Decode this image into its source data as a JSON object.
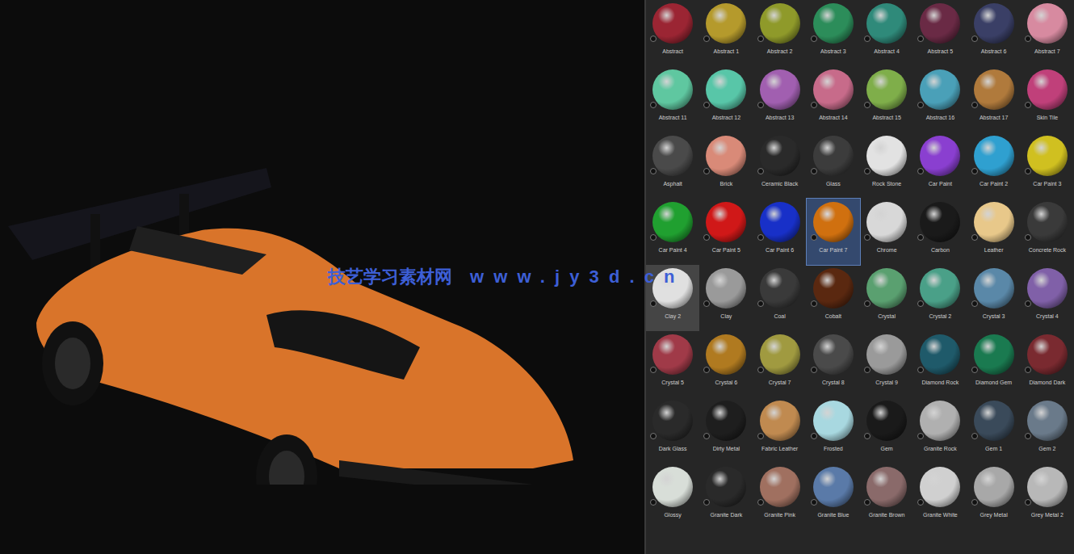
{
  "watermark": {
    "name": "技艺学习素材网",
    "url": "www.jy3d.cn"
  },
  "materials": [
    {
      "label": "Abstract",
      "color": "#9b2533",
      "selected": false,
      "hovered": false
    },
    {
      "label": "Abstract 1",
      "color": "#b59a2c",
      "selected": false,
      "hovered": false
    },
    {
      "label": "Abstract 2",
      "color": "#8f9a2a",
      "selected": false,
      "hovered": false
    },
    {
      "label": "Abstract 3",
      "color": "#2c8d5a",
      "selected": false,
      "hovered": false
    },
    {
      "label": "Abstract 4",
      "color": "#2f8a7a",
      "selected": false,
      "hovered": false
    },
    {
      "label": "Abstract 5",
      "color": "#6a2a45",
      "selected": false,
      "hovered": false
    },
    {
      "label": "Abstract 6",
      "color": "#3a3f66",
      "selected": false,
      "hovered": false
    },
    {
      "label": "Abstract 7",
      "color": "#d78aa0",
      "selected": false,
      "hovered": false
    },
    {
      "label": "Abstract 11",
      "color": "#5fc7a0",
      "selected": false,
      "hovered": false
    },
    {
      "label": "Abstract 12",
      "color": "#58c6a8",
      "selected": false,
      "hovered": false
    },
    {
      "label": "Abstract 13",
      "color": "#a15fb0",
      "selected": false,
      "hovered": false
    },
    {
      "label": "Abstract 14",
      "color": "#c76b8a",
      "selected": false,
      "hovered": false
    },
    {
      "label": "Abstract 15",
      "color": "#7fae4a",
      "selected": false,
      "hovered": false
    },
    {
      "label": "Abstract 16",
      "color": "#4aa0b8",
      "selected": false,
      "hovered": false
    },
    {
      "label": "Abstract 17",
      "color": "#b07a3c",
      "selected": false,
      "hovered": false
    },
    {
      "label": "Skin Tile",
      "color": "#c0407a",
      "selected": false,
      "hovered": false
    },
    {
      "label": "Asphalt",
      "color": "#4a4a4a",
      "selected": false,
      "hovered": false
    },
    {
      "label": "Brick",
      "color": "#d98a78",
      "selected": false,
      "hovered": false
    },
    {
      "label": "Ceramic Black",
      "color": "#2a2a2a",
      "selected": false,
      "hovered": false
    },
    {
      "label": "Glass",
      "color": "#3c3c3c",
      "selected": false,
      "hovered": false
    },
    {
      "label": "Rock Stone",
      "color": "#e2e2e2",
      "selected": false,
      "hovered": false
    },
    {
      "label": "Car Paint",
      "color": "#8a3fd0",
      "selected": false,
      "hovered": false
    },
    {
      "label": "Car Paint 2",
      "color": "#2fa0d0",
      "selected": false,
      "hovered": false
    },
    {
      "label": "Car Paint 3",
      "color": "#d0c020",
      "selected": false,
      "hovered": false
    },
    {
      "label": "Car Paint 4",
      "color": "#20a030",
      "selected": false,
      "hovered": false
    },
    {
      "label": "Car Paint 5",
      "color": "#d01818",
      "selected": false,
      "hovered": false
    },
    {
      "label": "Car Paint 6",
      "color": "#1830c8",
      "selected": false,
      "hovered": false
    },
    {
      "label": "Car Paint 7",
      "color": "#d0700f",
      "selected": true,
      "hovered": false
    },
    {
      "label": "Chrome",
      "color": "#d8d8d8",
      "selected": false,
      "hovered": false
    },
    {
      "label": "Carbon",
      "color": "#1a1a1a",
      "selected": false,
      "hovered": false
    },
    {
      "label": "Leather",
      "color": "#e8c88a",
      "selected": false,
      "hovered": false
    },
    {
      "label": "Concrete Rock",
      "color": "#3a3a3a",
      "selected": false,
      "hovered": false
    },
    {
      "label": "Clay 2",
      "color": "#e0e0e0",
      "selected": false,
      "hovered": true
    },
    {
      "label": "Clay",
      "color": "#9a9a9a",
      "selected": false,
      "hovered": false
    },
    {
      "label": "Coal",
      "color": "#3a3a3a",
      "selected": false,
      "hovered": false
    },
    {
      "label": "Cobalt",
      "color": "#5a2810",
      "selected": false,
      "hovered": false
    },
    {
      "label": "Crystal",
      "color": "#5aa070",
      "selected": false,
      "hovered": false
    },
    {
      "label": "Crystal 2",
      "color": "#4aa088",
      "selected": false,
      "hovered": false
    },
    {
      "label": "Crystal 3",
      "color": "#5a88a8",
      "selected": false,
      "hovered": false
    },
    {
      "label": "Crystal 4",
      "color": "#8060a8",
      "selected": false,
      "hovered": false
    },
    {
      "label": "Crystal 5",
      "color": "#a03a48",
      "selected": false,
      "hovered": false
    },
    {
      "label": "Crystal 6",
      "color": "#b07a20",
      "selected": false,
      "hovered": false
    },
    {
      "label": "Crystal 7",
      "color": "#a09a40",
      "selected": false,
      "hovered": false
    },
    {
      "label": "Crystal 8",
      "color": "#4a4a4a",
      "selected": false,
      "hovered": false
    },
    {
      "label": "Crystal 9",
      "color": "#9a9a9a",
      "selected": false,
      "hovered": false
    },
    {
      "label": "Diamond Rock",
      "color": "#1f5a6a",
      "selected": false,
      "hovered": false
    },
    {
      "label": "Diamond Gem",
      "color": "#1a7a50",
      "selected": false,
      "hovered": false
    },
    {
      "label": "Diamond Dark",
      "color": "#7a2a30",
      "selected": false,
      "hovered": false
    },
    {
      "label": "Dark Glass",
      "color": "#2a2a2a",
      "selected": false,
      "hovered": false
    },
    {
      "label": "Dirty Metal",
      "color": "#1e1e1e",
      "selected": false,
      "hovered": false
    },
    {
      "label": "Fabric Leather",
      "color": "#c08a50",
      "selected": false,
      "hovered": false
    },
    {
      "label": "Frosted",
      "color": "#a8d8e0",
      "selected": false,
      "hovered": false
    },
    {
      "label": "Gem",
      "color": "#1a1a1a",
      "selected": false,
      "hovered": false
    },
    {
      "label": "Granite Rock",
      "color": "#b0b0b0",
      "selected": false,
      "hovered": false
    },
    {
      "label": "Gem 1",
      "color": "#3a4a5a",
      "selected": false,
      "hovered": false
    },
    {
      "label": "Gem 2",
      "color": "#6a7a8a",
      "selected": false,
      "hovered": false
    },
    {
      "label": "Glossy",
      "color": "#d8ded8",
      "selected": false,
      "hovered": false
    },
    {
      "label": "Granite Dark",
      "color": "#2a2a2a",
      "selected": false,
      "hovered": false
    },
    {
      "label": "Granite Pink",
      "color": "#a07060",
      "selected": false,
      "hovered": false
    },
    {
      "label": "Granite Blue",
      "color": "#5a7aa8",
      "selected": false,
      "hovered": false
    },
    {
      "label": "Granite Brown",
      "color": "#8a6a6a",
      "selected": false,
      "hovered": false
    },
    {
      "label": "Granite White",
      "color": "#d0d0d0",
      "selected": false,
      "hovered": false
    },
    {
      "label": "Grey Metal",
      "color": "#a8a8a8",
      "selected": false,
      "hovered": false
    },
    {
      "label": "Grey Metal 2",
      "color": "#b8b8b8",
      "selected": false,
      "hovered": false
    }
  ]
}
